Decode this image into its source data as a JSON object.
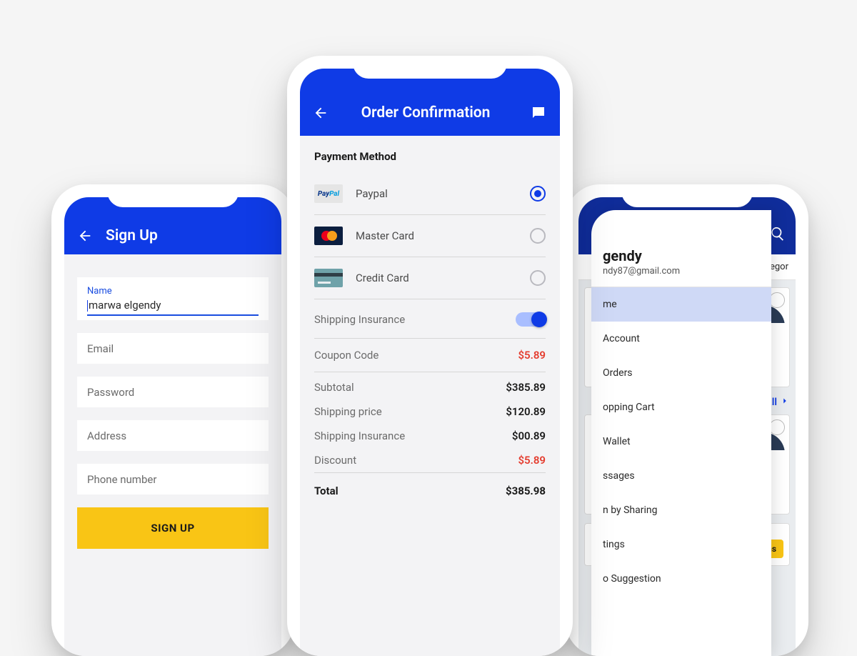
{
  "phone1": {
    "header": {
      "title": "Sign Up"
    },
    "form": {
      "name": {
        "label": "Name",
        "value": "marwa elgendy"
      },
      "email_placeholder": "Email",
      "password_placeholder": "Password",
      "address_placeholder": "Address",
      "phone_placeholder": "Phone number"
    },
    "submit_label": "SIGN UP"
  },
  "phone2": {
    "header": {
      "title": "Order Confirmation"
    },
    "payment_section_title": "Payment Method",
    "methods": [
      {
        "label": "Paypal",
        "selected": true
      },
      {
        "label": "Master Card",
        "selected": false
      },
      {
        "label": "Credit Card",
        "selected": false
      }
    ],
    "shipping_insurance_label": "Shipping Insurance",
    "shipping_insurance_on": true,
    "coupon": {
      "label": "Coupon Code",
      "value": "$5.89"
    },
    "summary": [
      {
        "label": "Subtotal",
        "value": "$385.89"
      },
      {
        "label": "Shipping price",
        "value": "$120.89"
      },
      {
        "label": "Shipping Insurance",
        "value": "$00.89"
      },
      {
        "label": "Discount",
        "value": "$5.89",
        "highlight": true
      }
    ],
    "total": {
      "label": "Total",
      "value": "$385.98"
    }
  },
  "phone3": {
    "profile": {
      "name_fragment": "gendy",
      "email_fragment": "ndy87@gmail.com"
    },
    "menu": [
      {
        "label": "me",
        "active": true
      },
      {
        "label": "Account"
      },
      {
        "label": "Orders"
      },
      {
        "label": "opping Cart"
      },
      {
        "label": "Wallet"
      },
      {
        "label": "ssages"
      },
      {
        "label": "n by Sharing"
      },
      {
        "label": "tings"
      },
      {
        "label": "o Suggestion"
      }
    ],
    "categories_fragment": "ategor",
    "view_all_label": "v all",
    "pill_fragment": "ns"
  }
}
